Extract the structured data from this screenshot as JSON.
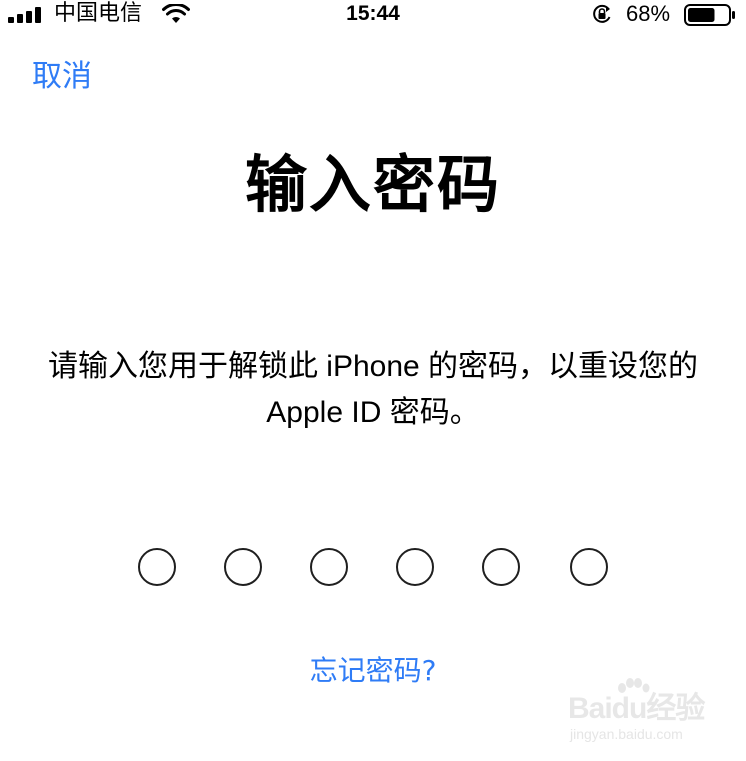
{
  "status_bar": {
    "carrier": "中国电信",
    "time": "15:44",
    "battery_percent": "68%",
    "battery_level": 0.68,
    "icons": [
      "signal-icon",
      "wifi-icon",
      "rotation-lock-icon",
      "battery-icon"
    ]
  },
  "nav": {
    "cancel_label": "取消"
  },
  "main": {
    "title": "输入密码",
    "description": "请输入您用于解锁此 iPhone 的密码，以重设您的 Apple ID 密码。",
    "passcode_length": 6,
    "passcode_entered": 0,
    "forgot_label": "忘记密码?"
  },
  "watermark": {
    "logo_text": "Baidu经验",
    "url_text": "jingyan.baidu.com"
  },
  "colors": {
    "accent": "#2f7cf6",
    "text": "#000000",
    "background": "#ffffff"
  }
}
